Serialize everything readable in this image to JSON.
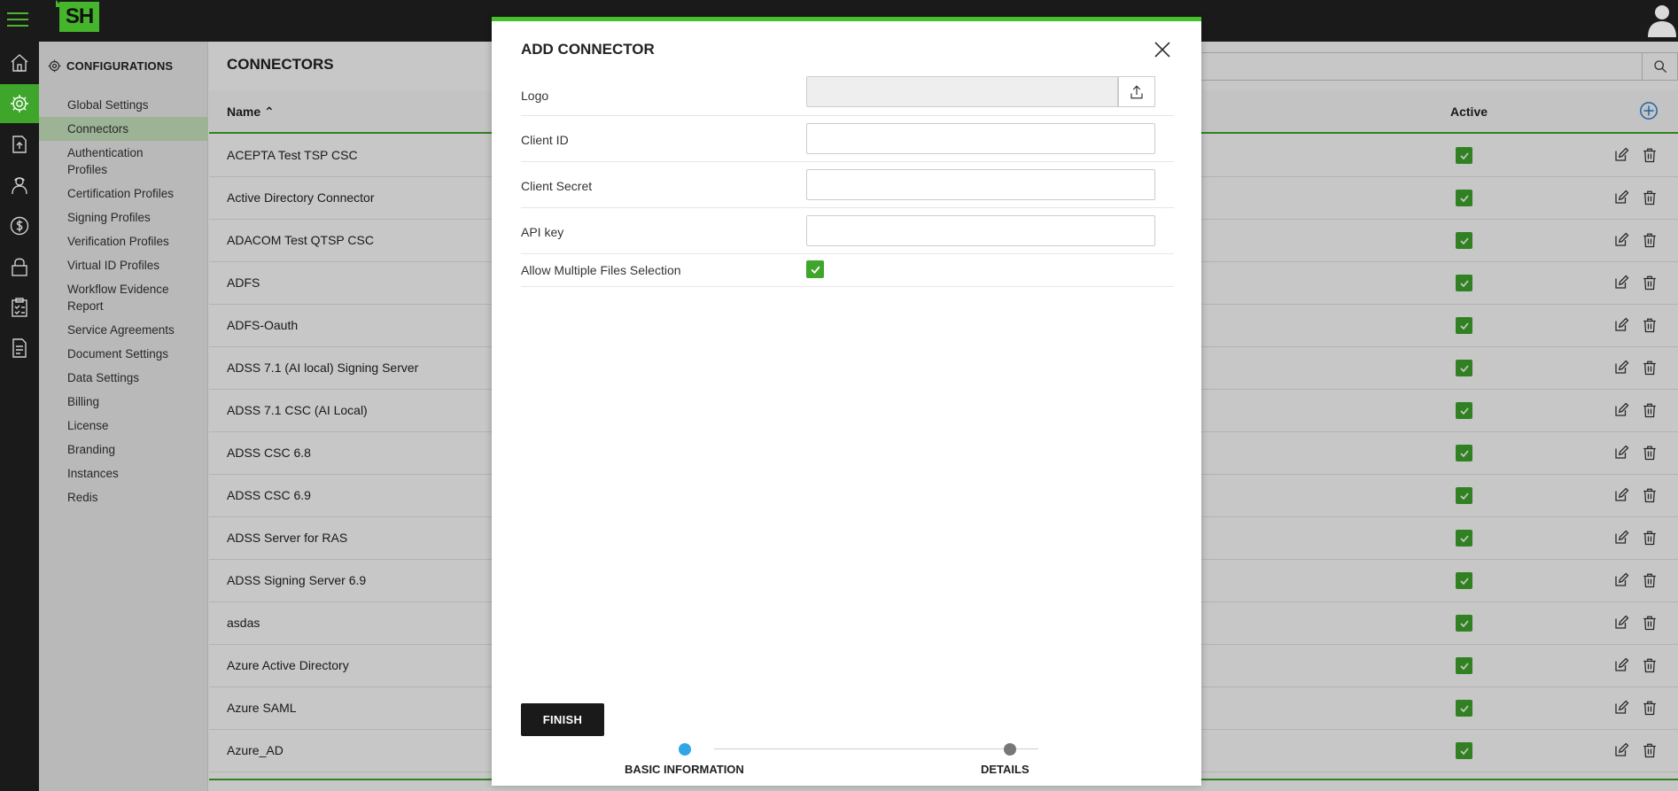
{
  "app": {
    "logo_text": "SH"
  },
  "sidebar": {
    "title": "CONFIGURATIONS",
    "items": [
      {
        "label": "Global Settings",
        "active": false
      },
      {
        "label": "Connectors",
        "active": true
      },
      {
        "label": "Authentication Profiles",
        "active": false
      },
      {
        "label": "Certification Profiles",
        "active": false
      },
      {
        "label": "Signing Profiles",
        "active": false
      },
      {
        "label": "Verification Profiles",
        "active": false
      },
      {
        "label": "Virtual ID Profiles",
        "active": false
      },
      {
        "label": "Workflow Evidence Report",
        "active": false
      },
      {
        "label": "Service Agreements",
        "active": false
      },
      {
        "label": "Document Settings",
        "active": false
      },
      {
        "label": "Data Settings",
        "active": false
      },
      {
        "label": "Billing",
        "active": false
      },
      {
        "label": "License",
        "active": false
      },
      {
        "label": "Branding",
        "active": false
      },
      {
        "label": "Instances",
        "active": false
      },
      {
        "label": "Redis",
        "active": false
      }
    ]
  },
  "rail_icons": [
    "home-icon",
    "gear-icon",
    "upload-document-icon",
    "user-support-icon",
    "dollar-icon",
    "lock-icon",
    "clipboard-icon",
    "report-icon"
  ],
  "content": {
    "title": "CONNECTORS",
    "columns": {
      "name": "Name",
      "active": "Active"
    },
    "rows": [
      "ACEPTA Test TSP CSC",
      "Active Directory Connector",
      "ADACOM Test QTSP CSC",
      "ADFS",
      "ADFS-Oauth",
      "ADSS 7.1 (AI local) Signing Server",
      "ADSS 7.1 CSC (AI Local)",
      "ADSS CSC 6.8",
      "ADSS CSC 6.9",
      "ADSS Server for RAS",
      "ADSS Signing Server 6.9",
      "asdas",
      "Azure Active Directory",
      "Azure SAML",
      "Azure_AD"
    ]
  },
  "modal": {
    "title": "ADD CONNECTOR",
    "fields": {
      "logo": "Logo",
      "client_id": "Client ID",
      "client_secret": "Client Secret",
      "api_key": "API key",
      "allow_multiple": "Allow Multiple Files Selection"
    },
    "values": {
      "client_id": "",
      "client_secret": "",
      "api_key": "",
      "allow_multiple": true
    },
    "finish_label": "FINISH",
    "steps": [
      "BASIC INFORMATION",
      "DETAILS"
    ],
    "current_step": "BASIC INFORMATION"
  },
  "colors": {
    "accent": "#3fa62c",
    "modal_top_border": "#45c12c",
    "step_active": "#32a5e8",
    "step_inactive": "#777777",
    "topbar": "#1a1a1a"
  }
}
